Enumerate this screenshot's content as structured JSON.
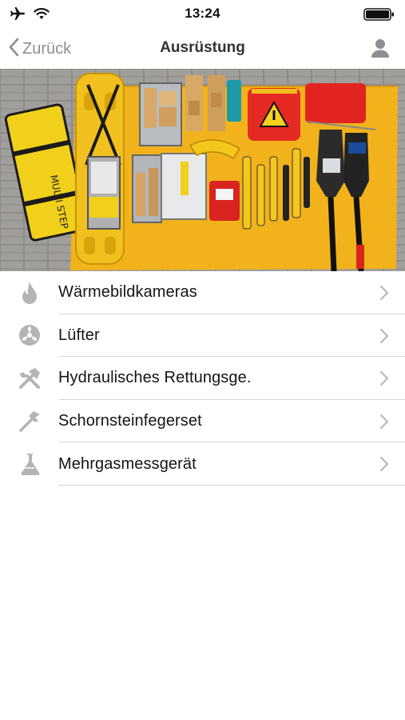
{
  "status_bar": {
    "time": "13:24",
    "icons": [
      "airplane-icon",
      "wifi-icon",
      "battery-icon"
    ]
  },
  "nav": {
    "back_label": "Zurück",
    "title": "Ausrüstung",
    "right_icon": "person-icon"
  },
  "hero_image": {
    "label": "MULTI STEP"
  },
  "items": [
    {
      "label": "Wärmebildkameras",
      "icon": "flame-icon"
    },
    {
      "label": "Lüfter",
      "icon": "fan-icon"
    },
    {
      "label": "Hydraulisches Rettungsge.",
      "icon": "tools-icon"
    },
    {
      "label": "Schornsteinfegerset",
      "icon": "hammer-icon"
    },
    {
      "label": "Mehrgasmessgerät",
      "icon": "flask-icon"
    }
  ],
  "colors": {
    "accent_gray": "#8e8e93",
    "icon_gray": "#b4b4b4",
    "separator": "#d6d6d6",
    "tarp_yellow": "#f2b21c"
  }
}
